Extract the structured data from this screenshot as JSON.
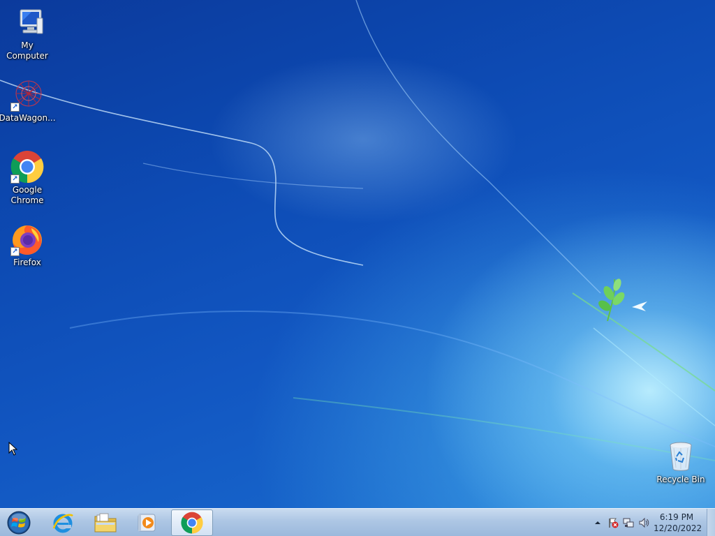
{
  "desktop": {
    "icons": [
      {
        "label": "My Computer",
        "icon": "computer-icon"
      },
      {
        "label": "DataWagon...",
        "icon": "datawagon-icon"
      },
      {
        "label": "Google Chrome",
        "icon": "chrome-icon"
      },
      {
        "label": "Firefox",
        "icon": "firefox-icon"
      },
      {
        "label": "Recycle Bin",
        "icon": "recycle-bin-icon"
      }
    ]
  },
  "taskbar": {
    "start": {
      "icon": "windows-start-orb-icon"
    },
    "pinned": [
      {
        "icon": "internet-explorer-icon",
        "active": false
      },
      {
        "icon": "file-explorer-icon",
        "active": false
      },
      {
        "icon": "media-player-icon",
        "active": false
      },
      {
        "icon": "chrome-icon",
        "active": true
      }
    ],
    "tray": {
      "icons": [
        "show-hidden-icons-arrow-icon",
        "action-center-flag-icon",
        "network-icon",
        "volume-icon"
      ]
    },
    "clock": {
      "time": "6:19 PM",
      "date": "12/20/2022"
    }
  },
  "colors": {
    "desktop_blue": "#0d4bb4",
    "taskbar": "#adc6e4"
  }
}
